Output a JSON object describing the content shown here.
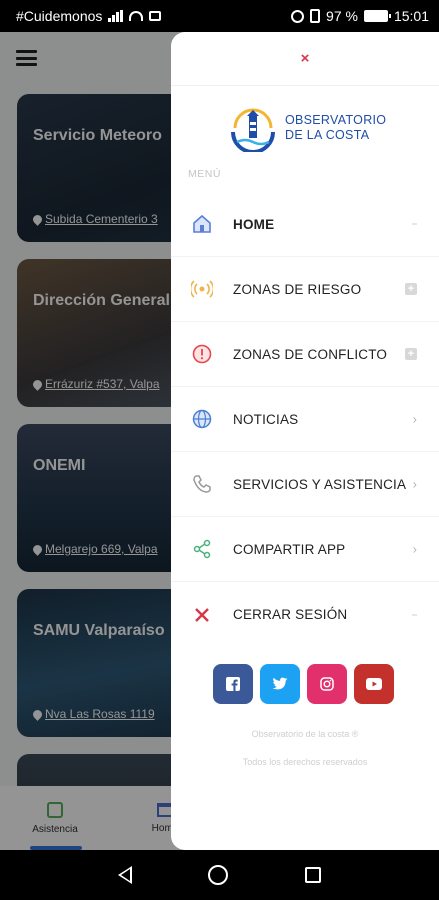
{
  "status_bar": {
    "carrier": "#Cuidemonos",
    "battery": "97 %",
    "time": "15:01"
  },
  "cards": [
    {
      "title": "Servicio Meteoro",
      "address": "Subida Cementerio 3"
    },
    {
      "title": "Dirección General Marina Mercante",
      "address": "Errázuriz #537, Valpa"
    },
    {
      "title": "ONEMI",
      "address": "Melgarejo 669, Valpa"
    },
    {
      "title": "SAMU Valparaíso",
      "address": "Nva Las Rosas 1119"
    },
    {
      "title": "",
      "address": ""
    }
  ],
  "bottom_nav": {
    "items": [
      {
        "label": "Asistencia",
        "icon": "phone-icon"
      },
      {
        "label": "Home",
        "icon": "home-icon"
      }
    ]
  },
  "drawer": {
    "close": "×",
    "logo": {
      "line1": "OBSERVATORIO",
      "line2": "DE LA COSTA"
    },
    "menu_label": "MENÚ",
    "items": [
      {
        "label": "HOME",
        "icon": "home-icon",
        "icon_color": "#5b7fd6",
        "trail": "-"
      },
      {
        "label": "ZONAS DE RIESGO",
        "icon": "signal-broadcast-icon",
        "icon_color": "#f0b24a",
        "trail": "+"
      },
      {
        "label": "ZONAS DE CONFLICTO",
        "icon": "alert-circle-icon",
        "icon_color": "#e5474c",
        "trail": "+"
      },
      {
        "label": "NOTICIAS",
        "icon": "globe-icon",
        "icon_color": "#4a7fd0",
        "trail": ">"
      },
      {
        "label": "SERVICIOS Y ASISTENCIA",
        "icon": "phone-icon",
        "icon_color": "#9a9a9a",
        "trail": ">"
      },
      {
        "label": "COMPARTIR APP",
        "icon": "share-icon",
        "icon_color": "#4cb07a",
        "trail": ">"
      },
      {
        "label": "CERRAR SESIÓN",
        "icon": "close-icon",
        "icon_color": "#d9354a",
        "trail": "-"
      }
    ],
    "socials": [
      {
        "name": "facebook-icon",
        "glyph": "f",
        "color": "#3b5998"
      },
      {
        "name": "twitter-icon",
        "glyph": "t",
        "color": "#1da1f2"
      },
      {
        "name": "instagram-icon",
        "glyph": "◎",
        "color": "#e1306c"
      },
      {
        "name": "youtube-icon",
        "glyph": "▶",
        "color": "#c4302b"
      }
    ],
    "footer": {
      "line1": "Observatorio de la costa ®",
      "line2": "Todos los derechos reservados"
    }
  }
}
